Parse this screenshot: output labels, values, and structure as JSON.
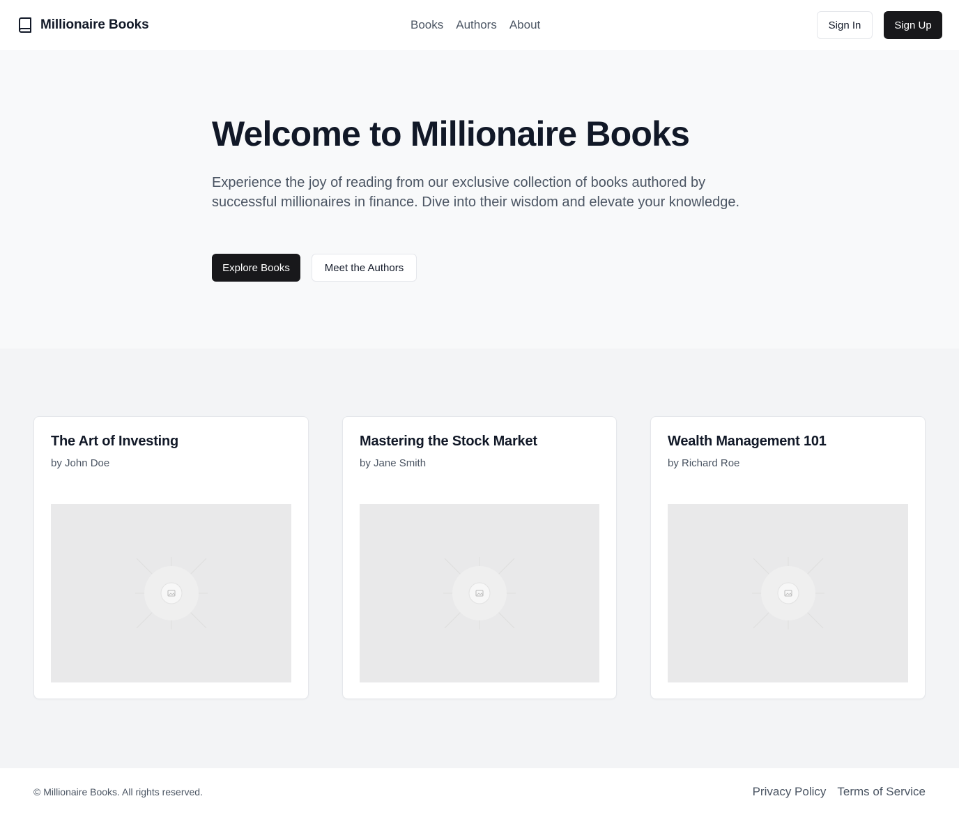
{
  "header": {
    "brand": "Millionaire Books",
    "nav": [
      "Books",
      "Authors",
      "About"
    ],
    "sign_in": "Sign In",
    "sign_up": "Sign Up"
  },
  "hero": {
    "title": "Welcome to Millionaire Books",
    "text": "Experience the joy of reading from our exclusive collection of books authored by successful millionaires in finance. Dive into their wisdom and elevate your knowledge.",
    "explore_button": "Explore Books",
    "meet_button": "Meet the Authors"
  },
  "books": [
    {
      "title": "The Art of Investing",
      "author": "by John Doe",
      "image_icon": "image-placeholder-icon"
    },
    {
      "title": "Mastering the Stock Market",
      "author": "by Jane Smith",
      "image_icon": "image-placeholder-icon"
    },
    {
      "title": "Wealth Management 101",
      "author": "by Richard Roe",
      "image_icon": "image-placeholder-icon"
    }
  ],
  "footer": {
    "copyright": "© Millionaire Books. All rights reserved.",
    "links": [
      "Privacy Policy",
      "Terms of Service"
    ]
  },
  "colors": {
    "primary_dark": "#18181b",
    "hero_bg": "#f8f9fa",
    "section_bg": "#f3f4f6",
    "placeholder_bg": "#e9e9ea",
    "muted_text": "#4b5563"
  }
}
